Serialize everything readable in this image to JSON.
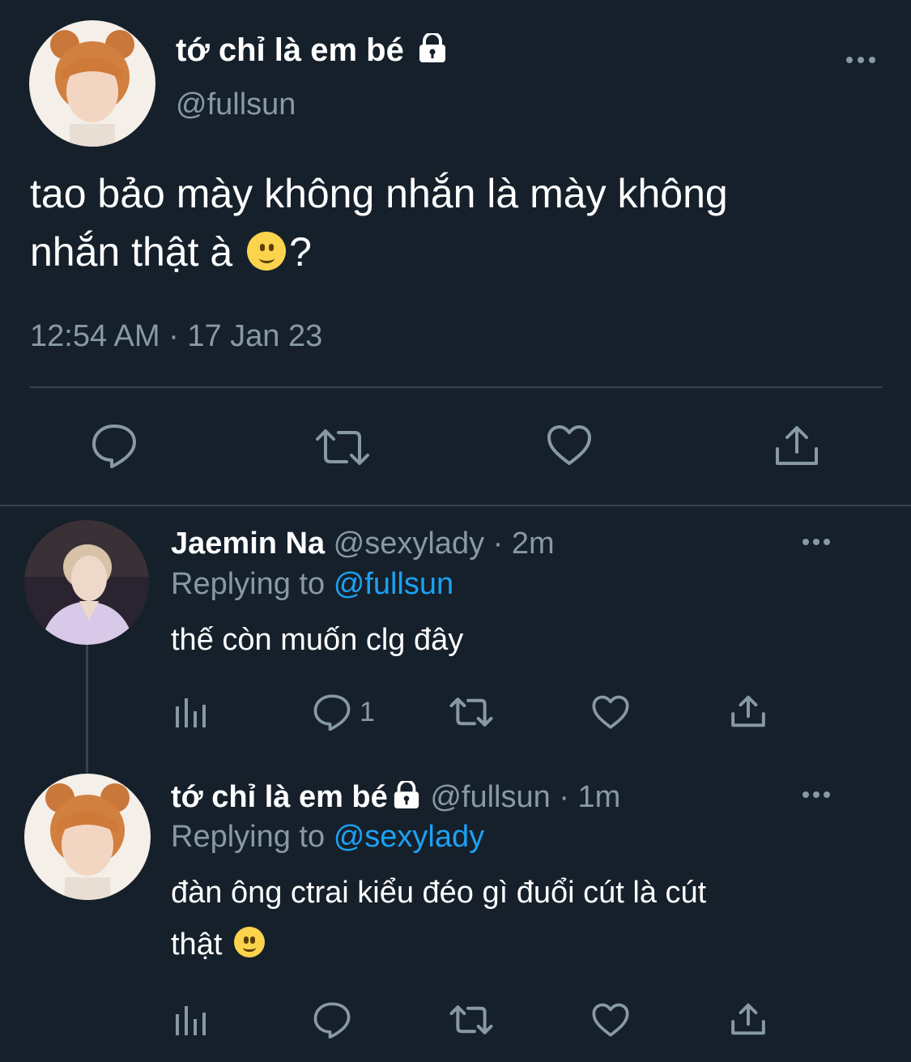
{
  "main_tweet": {
    "display_name": "tớ chỉ là em bé",
    "handle": "@fullsun",
    "text_line1": "tao bảo mày không nhắn là mày không",
    "text_line2_before": "nhắn thật à",
    "text_line2_after": "?",
    "timestamp": "12:54 AM · 17 Jan 23"
  },
  "reply1": {
    "display_name": "Jaemin Na",
    "handle": "@sexylady",
    "time": "· 2m",
    "replying_label": "Replying to",
    "replying_handle": "@fullsun",
    "text": "thế còn muốn clg đây",
    "reply_count": "1"
  },
  "reply2": {
    "display_name": "tớ chỉ là em bé",
    "handle": "@fullsun",
    "time": "· 1m",
    "replying_label": "Replying to",
    "replying_handle": "@sexylady",
    "text_line1": "đàn ông ctrai kiểu đéo gì đuổi cút là cút",
    "text_line2": "thật"
  },
  "icons": {
    "reply": "reply-icon",
    "retweet": "retweet-icon",
    "like": "heart-icon",
    "share": "share-icon",
    "analytics": "analytics-icon",
    "more": "more-icon",
    "lock": "lock-icon",
    "emoji": "slightly-smiling-face-emoji"
  },
  "colors": {
    "background": "#15202b",
    "muted": "#8899a6",
    "link": "#1da1f2",
    "divider": "#38444d"
  }
}
